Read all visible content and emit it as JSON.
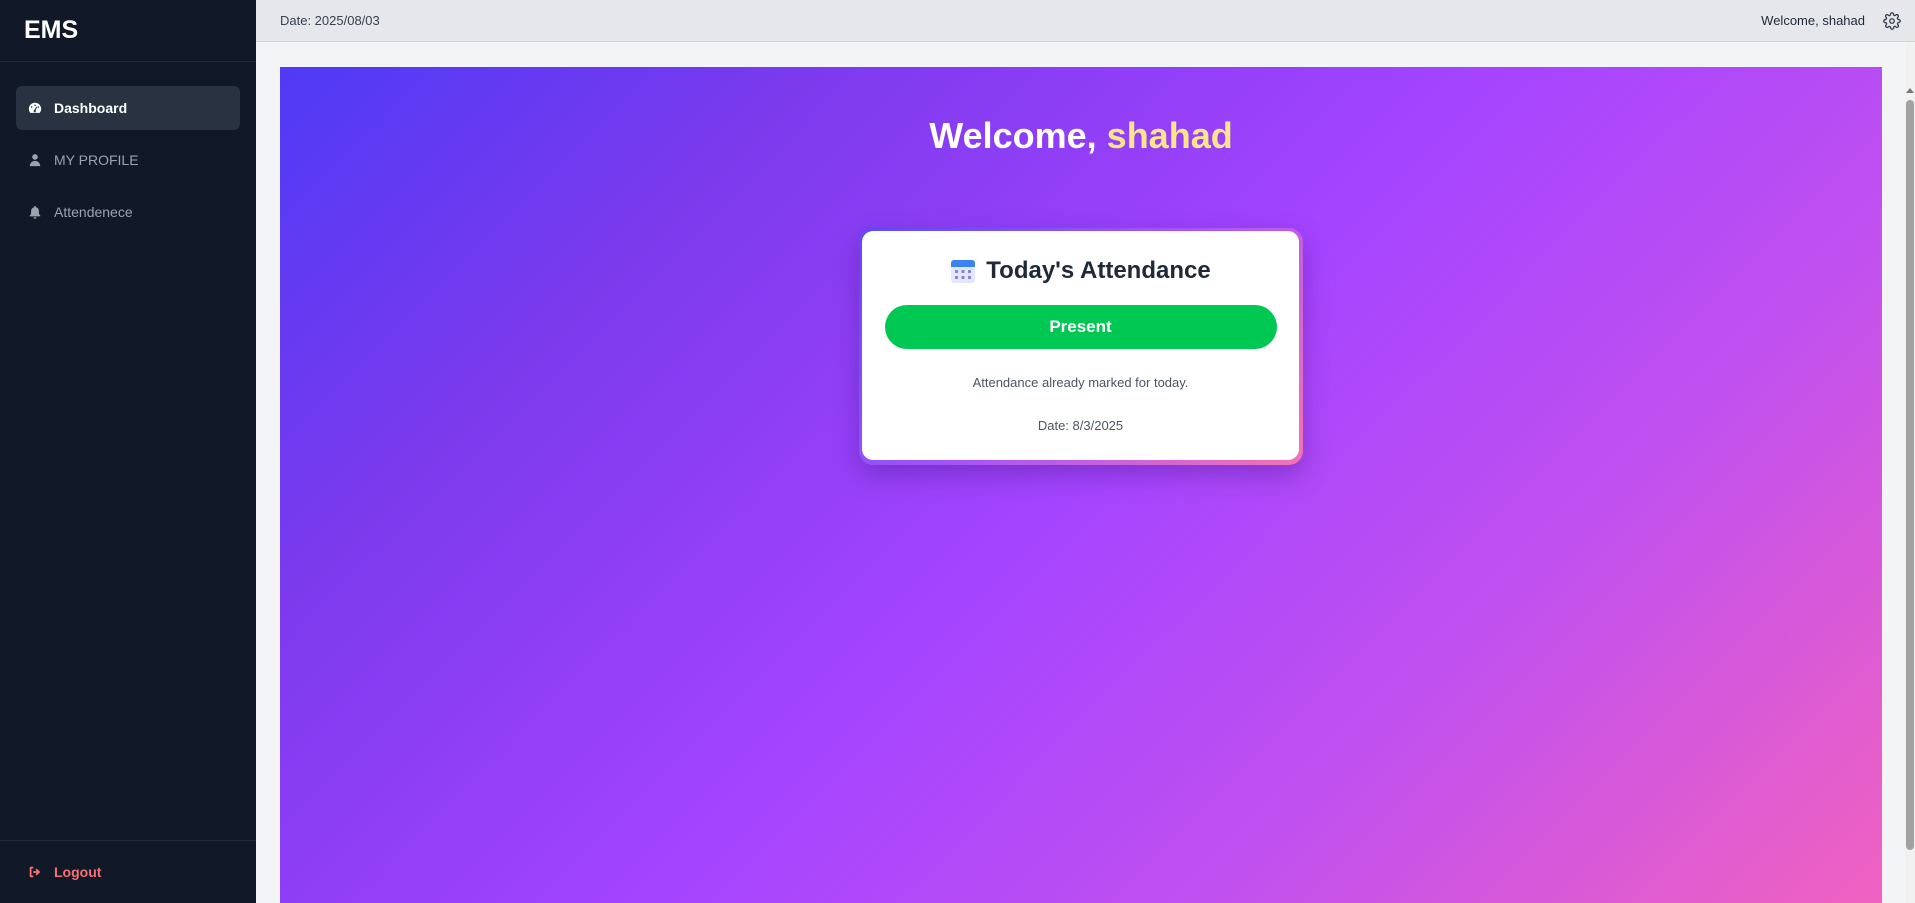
{
  "brand": {
    "name": "EMS"
  },
  "sidebar": {
    "items": [
      {
        "label": "Dashboard",
        "icon": "dashboard-icon",
        "active": true
      },
      {
        "label": "MY PROFILE",
        "icon": "user-icon",
        "active": false
      },
      {
        "label": "Attendenece",
        "icon": "bell-icon",
        "active": false
      }
    ],
    "logout_label": "Logout"
  },
  "topbar": {
    "date": "Date: 2025/08/03",
    "welcome": "Welcome, shahad",
    "settings_icon": "gear-icon"
  },
  "hero": {
    "greeting": "Welcome, ",
    "username": "shahad"
  },
  "attendance_card": {
    "title": "Today's Attendance",
    "icon": "calendar-icon",
    "status_label": "Present",
    "message": "Attendance already marked for today.",
    "date": "Date: 8/3/2025"
  },
  "colors": {
    "sidebar_bg": "#111827",
    "present_green": "#00c853",
    "logout_red": "#f87171",
    "username_yellow": "#fde68a"
  }
}
